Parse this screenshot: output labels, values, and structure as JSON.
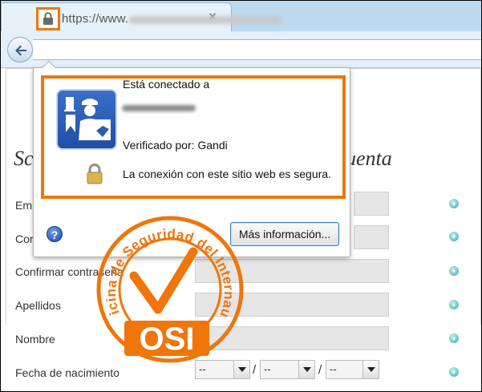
{
  "browser": {
    "url_prefix": "https://www."
  },
  "popup": {
    "connected_to": "Está conectado a",
    "verified_by": "Verificado por: Gandi",
    "secure_connection": "La conexión con este sitio web es segura.",
    "more_info_button": "Más información..."
  },
  "page": {
    "heading_left_partial": "Sc",
    "heading_right_partial": "uenta",
    "fields": [
      {
        "label": "Em",
        "value": ""
      },
      {
        "label": "Cor",
        "value": ""
      },
      {
        "label": "Confirmar contraseña",
        "value": ""
      },
      {
        "label": "Apellidos",
        "value": ""
      },
      {
        "label": "Nombre",
        "value": ""
      },
      {
        "label": "Fecha de nacimiento",
        "value": ""
      }
    ],
    "date_selects": [
      "--",
      "--",
      "--"
    ]
  },
  "stamp": {
    "ring_text": "Oficina de Seguridad del Internauta",
    "logo_text": "OSI"
  },
  "colors": {
    "highlight": "#f0760a",
    "chrome_blue": "#e3f0fa",
    "stamp_orange": "#f0760a"
  },
  "icons": [
    "back-arrow-icon",
    "padlock-icon",
    "identity-officer-icon",
    "help-icon",
    "info-icon",
    "close-icon",
    "dropdown-arrow-icon",
    "checkmark-icon"
  ]
}
